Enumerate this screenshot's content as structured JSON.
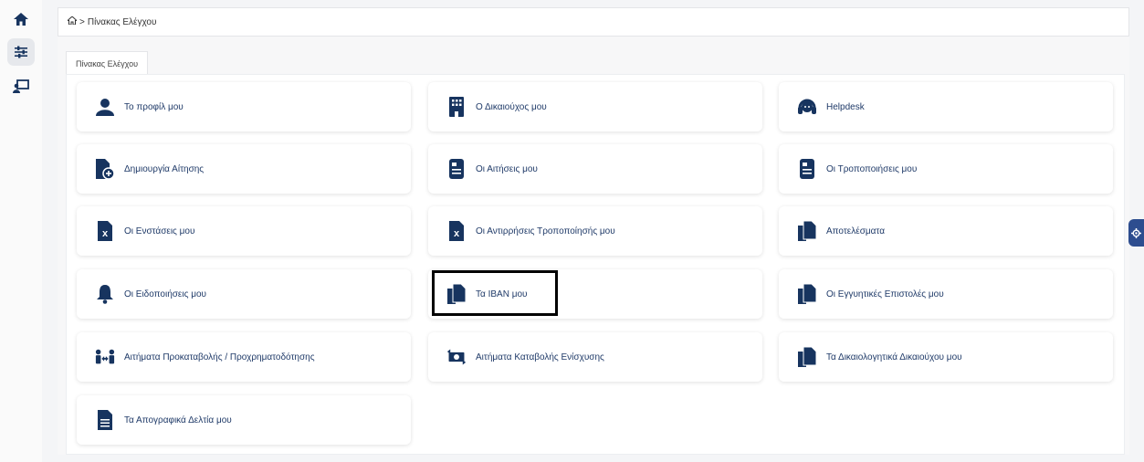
{
  "breadcrumb": {
    "home_icon": "home-icon",
    "separator": ">",
    "current": "Πίνακας Ελέγχου"
  },
  "tab": {
    "label": "Πίνακας Ελέγχου"
  },
  "cards": [
    {
      "label": "Το προφίλ μου",
      "icon": "user-icon"
    },
    {
      "label": "Ο Δικαιούχος μου",
      "icon": "building-icon"
    },
    {
      "label": "Helpdesk",
      "icon": "headset-icon"
    },
    {
      "label": "Δημιουργία Αίτησης",
      "icon": "file-add-icon"
    },
    {
      "label": "Οι Αιτήσεις μου",
      "icon": "document-icon"
    },
    {
      "label": "Οι Τροποποιήσεις μου",
      "icon": "document-icon"
    },
    {
      "label": "Οι Ενστάσεις μου",
      "icon": "file-excel-icon"
    },
    {
      "label": "Οι Αντιρρήσεις Τροποποίησής μου",
      "icon": "file-excel-icon"
    },
    {
      "label": "Αποτελέσματα",
      "icon": "copy-files-icon"
    },
    {
      "label": "Οι Ειδοποιήσεις μου",
      "icon": "bell-icon"
    },
    {
      "label": "Τα IBAN μου",
      "icon": "copy-files-icon"
    },
    {
      "label": "Οι Εγγυητικές Επιστολές μου",
      "icon": "copy-files-icon"
    },
    {
      "label": "Αιτήματα Προκαταβολής / Προχρηματοδότησης",
      "icon": "transfer-people-icon"
    },
    {
      "label": "Αιτήματα Καταβολής Ενίσχυσης",
      "icon": "money-exchange-icon"
    },
    {
      "label": "Τα Δικαιολογητικά Δικαιούχου μου",
      "icon": "copy-files-icon"
    },
    {
      "label": "Τα Απογραφικά Δελτία μου",
      "icon": "file-text-icon"
    }
  ],
  "colors": {
    "accent": "#17345f",
    "text": "#1f3a68",
    "settings_tab": "#2d4d8f"
  }
}
